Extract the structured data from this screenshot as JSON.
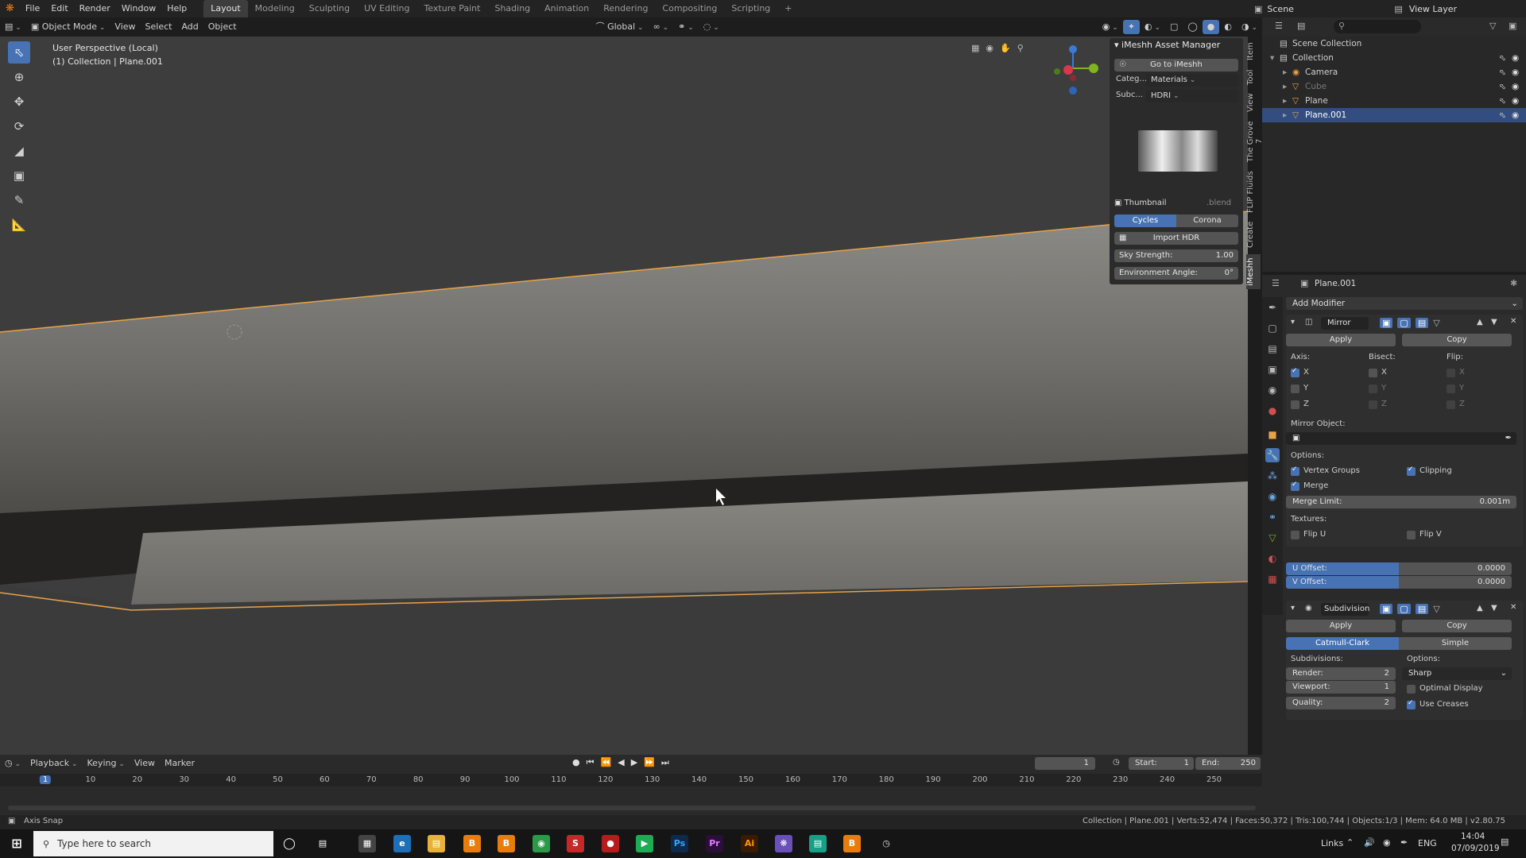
{
  "app": {
    "menu": [
      "File",
      "Edit",
      "Render",
      "Window",
      "Help"
    ],
    "workspaces": [
      "Layout",
      "Modeling",
      "Sculpting",
      "UV Editing",
      "Texture Paint",
      "Shading",
      "Animation",
      "Rendering",
      "Compositing",
      "Scripting"
    ],
    "active_workspace": "Layout",
    "scene_name": "Scene",
    "view_layer": "View Layer"
  },
  "viewport_header": {
    "mode": "Object Mode",
    "menus": [
      "View",
      "Select",
      "Add",
      "Object"
    ],
    "orientation": "Global"
  },
  "viewport": {
    "perspective": "User Perspective (Local)",
    "collection_info": "(1) Collection | Plane.001"
  },
  "imeshh": {
    "title": "iMeshh Asset Manager",
    "go_button": "Go to iMeshh",
    "category_label": "Categ...",
    "category_value": "Materials",
    "subcategory_label": "Subc...",
    "subcategory_value": "HDRI",
    "thumbnail_label": "Thumbnail",
    "blend_label": ".blend",
    "engine_cycles": "Cycles",
    "engine_corona": "Corona",
    "import_button": "Import HDR",
    "sky_strength_label": "Sky Strength:",
    "sky_strength_value": "1.00",
    "env_angle_label": "Environment Angle:",
    "env_angle_value": "0°"
  },
  "side_tabs": [
    "Item",
    "Tool",
    "View",
    "The Grove 7",
    "FLIP Fluids",
    "Create",
    "iMeshh"
  ],
  "outliner": {
    "root": "Scene Collection",
    "items": [
      {
        "name": "Collection",
        "indent": 1,
        "dim": false,
        "selected": false
      },
      {
        "name": "Camera",
        "indent": 2,
        "dim": false,
        "selected": false
      },
      {
        "name": "Cube",
        "indent": 2,
        "dim": true,
        "selected": false
      },
      {
        "name": "Plane",
        "indent": 2,
        "dim": false,
        "selected": false
      },
      {
        "name": "Plane.001",
        "indent": 2,
        "dim": false,
        "selected": true
      }
    ]
  },
  "properties": {
    "object_name": "Plane.001",
    "add_modifier": "Add Modifier",
    "mirror": {
      "name": "Mirror",
      "apply": "Apply",
      "copy": "Copy",
      "axis_label": "Axis:",
      "bisect_label": "Bisect:",
      "flip_label": "Flip:",
      "axes": [
        "X",
        "Y",
        "Z"
      ],
      "mirror_object_label": "Mirror Object:",
      "options_label": "Options:",
      "vertex_groups": "Vertex Groups",
      "clipping": "Clipping",
      "merge": "Merge",
      "merge_limit_label": "Merge Limit:",
      "merge_limit_value": "0.001m",
      "textures_label": "Textures:",
      "flip_u": "Flip U",
      "flip_v": "Flip V",
      "u_offset_label": "U Offset:",
      "u_offset_value": "0.0000",
      "v_offset_label": "V Offset:",
      "v_offset_value": "0.0000"
    },
    "subdivision": {
      "name": "Subdivision",
      "apply": "Apply",
      "copy": "Copy",
      "catmull": "Catmull-Clark",
      "simple": "Simple",
      "subdivisions_label": "Subdivisions:",
      "render_label": "Render:",
      "render_value": "2",
      "viewport_label": "Viewport:",
      "viewport_value": "1",
      "quality_label": "Quality:",
      "quality_value": "2",
      "options_label": "Options:",
      "options_value": "Sharp",
      "optimal_display": "Optimal Display",
      "use_creases": "Use Creases"
    }
  },
  "timeline": {
    "menus": [
      "Playback",
      "Keying",
      "View",
      "Marker"
    ],
    "current_frame": "1",
    "start_label": "Start:",
    "start_value": "1",
    "end_label": "End:",
    "end_value": "250",
    "ruler": [
      "1",
      "10",
      "20",
      "30",
      "40",
      "50",
      "60",
      "70",
      "80",
      "90",
      "100",
      "110",
      "120",
      "130",
      "140",
      "150",
      "160",
      "170",
      "180",
      "190",
      "200",
      "210",
      "220",
      "230",
      "240",
      "250"
    ]
  },
  "status": {
    "left": "Axis Snap",
    "right": "Collection | Plane.001 | Verts:52,474 | Faces:50,372 | Tris:100,744 | Objects:1/3 | Mem: 64.0 MB | v2.80.75"
  },
  "taskbar": {
    "search_placeholder": "Type here to search",
    "links": "Links",
    "lang": "ENG",
    "time": "14:04",
    "date": "07/09/2019"
  },
  "colors": {
    "accent": "#4772b3",
    "selection": "#334d80",
    "outline_orange": "#e8a24a"
  }
}
